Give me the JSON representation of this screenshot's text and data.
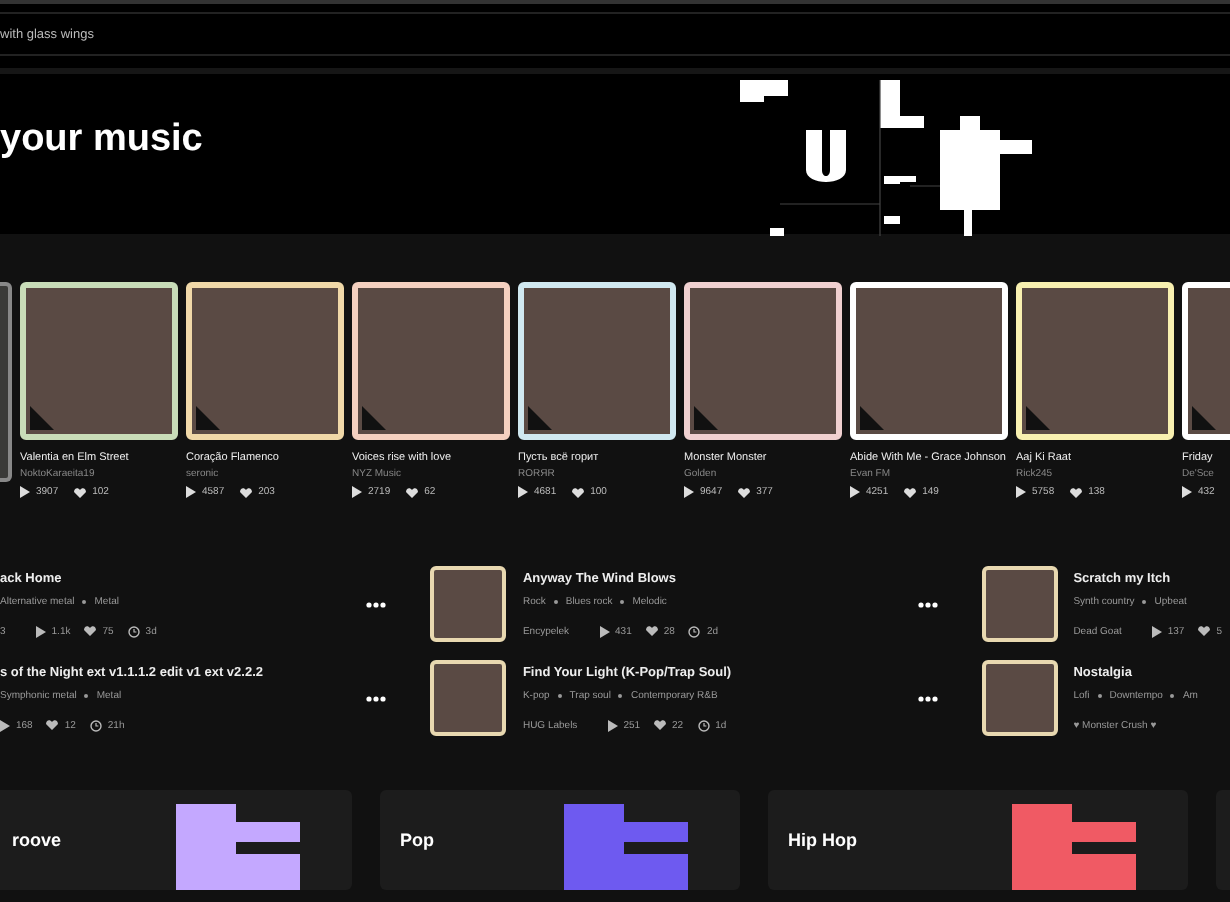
{
  "search": {
    "placeholder": "with glass wings"
  },
  "hero": {
    "title": "your music"
  },
  "songs": [
    {
      "title": "Valentia en Elm Street",
      "artist": "NoktoKaraeita19",
      "plays": "3907",
      "likes": "102",
      "color": "#c8dcb8"
    },
    {
      "title": "Coração Flamenco",
      "artist": "seronic",
      "plays": "4587",
      "likes": "203",
      "color": "#f0d8a8"
    },
    {
      "title": "Voices rise with love",
      "artist": "NYZ Music",
      "plays": "2719",
      "likes": "62",
      "color": "#f4d0c0"
    },
    {
      "title": "Пусть всё горит",
      "artist": "RORЯR",
      "plays": "4681",
      "likes": "100",
      "color": "#d0e8f0"
    },
    {
      "title": "Monster Monster",
      "artist": "Golden",
      "plays": "9647",
      "likes": "377",
      "color": "#f0d0d0"
    },
    {
      "title": "Abide With Me - Grace Johnson",
      "artist": "Evan FM",
      "plays": "4251",
      "likes": "149",
      "color": "#ffffff"
    },
    {
      "title": "Aaj Ki Raat",
      "artist": "Rick245",
      "plays": "5758",
      "likes": "138",
      "color": "#f8f0b0"
    },
    {
      "title": "Friday",
      "artist": "De'Sce",
      "plays": "432",
      "color": "#ffffff"
    }
  ],
  "tracks": [
    [
      {
        "title": "ack Home",
        "genres": [
          "Alternative metal",
          "Metal"
        ],
        "artist": "3",
        "plays": "1.1k",
        "likes": "75",
        "age": "3d"
      },
      {
        "title": "s of the Night ext v1.1.1.2 edit v1 ext v2.2.2",
        "genres": [
          "Symphonic metal",
          "Metal"
        ],
        "plays": "168",
        "likes": "12",
        "age": "21h"
      }
    ],
    [
      {
        "title": "Anyway The Wind Blows",
        "genres": [
          "Rock",
          "Blues rock",
          "Melodic"
        ],
        "artist": "Encypelek",
        "plays": "431",
        "likes": "28",
        "age": "2d"
      },
      {
        "title": "Find Your Light (K-Pop/Trap Soul)",
        "genres": [
          "K-pop",
          "Trap soul",
          "Contemporary R&B"
        ],
        "artist": "HUG Labels",
        "plays": "251",
        "likes": "22",
        "age": "1d"
      }
    ],
    [
      {
        "title": "Scratch my Itch",
        "genres": [
          "Synth country",
          "Upbeat"
        ],
        "artist": "Dead Goat",
        "plays": "137",
        "likes": "5"
      },
      {
        "title": "Nostalgia",
        "genres": [
          "Lofi",
          "Downtempo",
          "Am"
        ],
        "artist": "♥ Monster Crush ♥"
      }
    ]
  ],
  "genres": [
    {
      "name": "roove",
      "color": "#c4a8ff"
    },
    {
      "name": "Pop",
      "color": "#6e5af0"
    },
    {
      "name": "Hip Hop",
      "color": "#f05a64"
    }
  ]
}
